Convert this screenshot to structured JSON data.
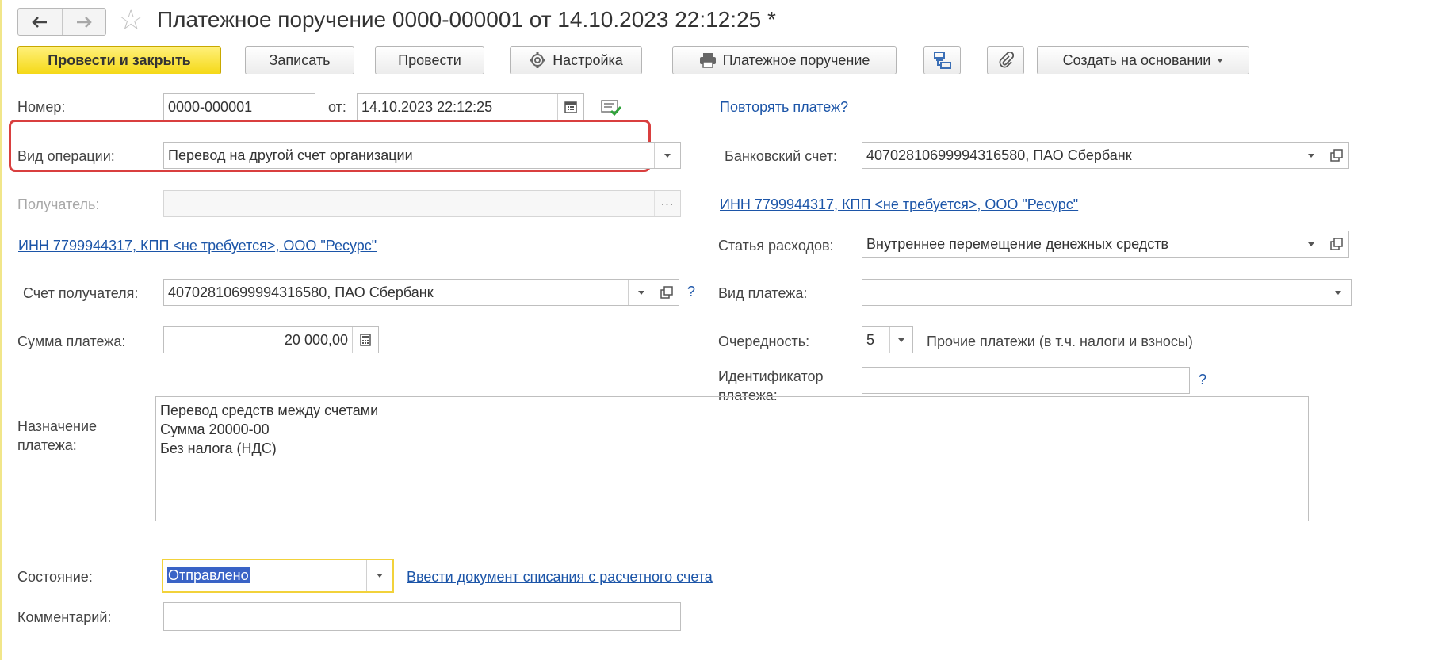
{
  "header": {
    "title": "Платежное поручение 0000-000001 от 14.10.2023 22:12:25 *"
  },
  "toolbar": {
    "post_close": "Провести и закрыть",
    "save": "Записать",
    "post": "Провести",
    "settings": "Настройка",
    "print": "Платежное поручение",
    "create_based": "Создать на основании"
  },
  "form": {
    "number_label": "Номер:",
    "number_value": "0000-000001",
    "date_label": "от:",
    "date_value": "14.10.2023 22:12:25",
    "repeat_link": "Повторять платеж?",
    "operation_label": "Вид операции:",
    "operation_value": "Перевод на другой счет организации",
    "bank_account_label": "Банковский счет:",
    "bank_account_value": "40702810699994316580, ПАО Сбербанк",
    "recipient_label": "Получатель:",
    "recipient_value": "",
    "inn_link_right": "ИНН 7799944317, КПП <не требуется>, ООО \"Ресурс\"",
    "inn_link_left": "ИНН 7799944317, КПП <не требуется>, ООО \"Ресурс\"",
    "expense_label": "Статья расходов:",
    "expense_value": "Внутреннее перемещение денежных средств",
    "recipient_account_label": "Счет получателя:",
    "recipient_account_value": "40702810699994316580, ПАО Сбербанк",
    "payment_type_label": "Вид платежа:",
    "payment_type_value": "",
    "amount_label": "Сумма платежа:",
    "amount_value": "20 000,00",
    "priority_label": "Очередность:",
    "priority_value": "5",
    "priority_desc": "Прочие платежи (в т.ч. налоги и взносы)",
    "identifier_label_1": "Идентификатор",
    "identifier_label_2": "платежа:",
    "identifier_value": "",
    "purpose_label_1": "Назначение",
    "purpose_label_2": "платежа:",
    "purpose_lines": [
      "Перевод средств между счетами",
      "Сумма 20000-00",
      "Без налога (НДС)"
    ],
    "status_label": "Состояние:",
    "status_value": "Отправлено",
    "write_off_link": "Ввести документ списания с расчетного счета",
    "comment_label": "Комментарий:",
    "comment_value": "",
    "help_mark": "?"
  },
  "colors": {
    "primary_button": "#f5d918",
    "link": "#1c55a8",
    "highlight_box": "#d93f3f",
    "focus_border": "#f2d23b",
    "selection": "#3a63c6"
  }
}
